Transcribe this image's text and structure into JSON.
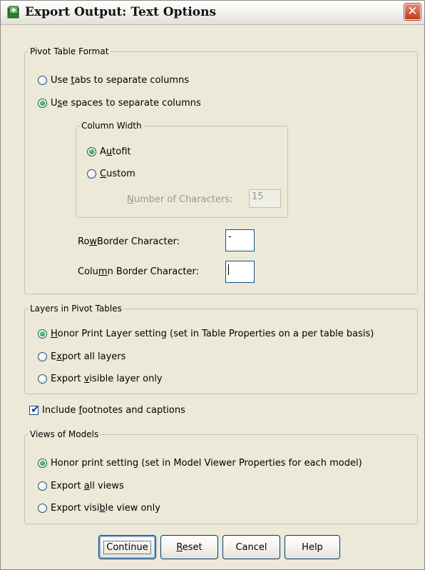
{
  "window": {
    "title": "Export Output: Text Options",
    "close_glyph": "✕"
  },
  "pivot_table_format": {
    "legend": "Pivot Table Format",
    "tabs_pre": "Use ",
    "tabs_key": "t",
    "tabs_post": "abs to separate columns",
    "tabs_checked": false,
    "spaces_pre": "U",
    "spaces_key": "s",
    "spaces_post": "e spaces to separate columns",
    "spaces_checked": true,
    "column_width": {
      "legend": "Column Width",
      "autofit_pre": "A",
      "autofit_key": "u",
      "autofit_post": "tofit",
      "autofit_checked": true,
      "custom_pre": "",
      "custom_key": "C",
      "custom_post": "ustom",
      "custom_checked": false,
      "num_chars_key": "N",
      "num_chars_post": "umber of Characters:",
      "num_chars_value": "15"
    },
    "row_border_pre": "Ro",
    "row_border_key": "w",
    "row_border_post": " Border Character:",
    "row_border_value": "-",
    "col_border_pre": "Colu",
    "col_border_key": "m",
    "col_border_post": "n Border Character:",
    "col_border_value": ""
  },
  "layers": {
    "legend": "Layers in Pivot Tables",
    "honor_key": "H",
    "honor_post": "onor Print Layer setting (set in Table Properties on a per table basis)",
    "honor_checked": true,
    "all_pre": "E",
    "all_key": "x",
    "all_post": "port all layers",
    "all_checked": false,
    "visible_pre": "Export ",
    "visible_key": "v",
    "visible_post": "isible layer only",
    "visible_checked": false
  },
  "footnotes": {
    "pre": "Include ",
    "key": "f",
    "post": "ootnotes and captions",
    "checked": true
  },
  "views": {
    "legend": "Views of Models",
    "honor_label": "Honor print setting (set in Model Viewer Properties for each model)",
    "honor_checked": true,
    "all_pre": "Export ",
    "all_key": "a",
    "all_post": "ll views",
    "all_checked": false,
    "visible_pre": "Export visi",
    "visible_key": "b",
    "visible_post": "le view only",
    "visible_checked": false
  },
  "buttons": {
    "continue": "Continue",
    "reset_key": "R",
    "reset_post": "eset",
    "cancel": "Cancel",
    "help": "Help"
  },
  "colors": {
    "dialog_bg": "#ece9d8",
    "radio_dot": "#1e9c2b",
    "close_red": "#c1391a",
    "button_border": "#003c74"
  },
  "icons": {
    "app": "export-output-icon",
    "close": "close-icon"
  }
}
